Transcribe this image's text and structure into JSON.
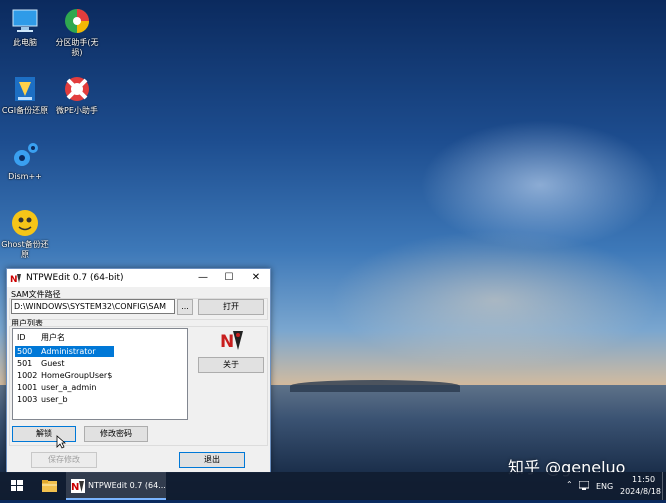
{
  "desktop": {
    "icons": [
      {
        "label": "此电脑"
      },
      {
        "label": "分区助手(无损)"
      },
      {
        "label": "CGI备份还原"
      },
      {
        "label": "微PE小助手"
      },
      {
        "label": "Dism++"
      },
      {
        "label": "Ghost备份还原"
      }
    ]
  },
  "window": {
    "title": "NTPWEdit 0.7 (64-bit)",
    "sam_label": "SAM文件路径",
    "sam_path": "D:\\WINDOWS\\SYSTEM32\\CONFIG\\SAM",
    "browse_label": "...",
    "open_label": "打开",
    "user_list_label": "用户列表",
    "columns": [
      "ID",
      "用户名"
    ],
    "users": [
      {
        "id": "500",
        "name": "Administrator",
        "selected": true
      },
      {
        "id": "501",
        "name": "Guest",
        "selected": false
      },
      {
        "id": "1002",
        "name": "HomeGroupUser$",
        "selected": false
      },
      {
        "id": "1001",
        "name": "user_a_admin",
        "selected": false
      },
      {
        "id": "1003",
        "name": "user_b",
        "selected": false
      }
    ],
    "about_label": "关于",
    "unlock_label": "解锁",
    "change_pw_label": "修改密码",
    "save_label": "保存修改",
    "exit_label": "退出"
  },
  "taskbar": {
    "app_label": "NTPWEdit 0.7 (64...",
    "lang": "ENG",
    "time": "11:50",
    "date": "2024/8/18"
  },
  "watermark": "知乎 @geneluo",
  "colors": {
    "selection": "#0078d7",
    "taskbar": "#101c30"
  }
}
